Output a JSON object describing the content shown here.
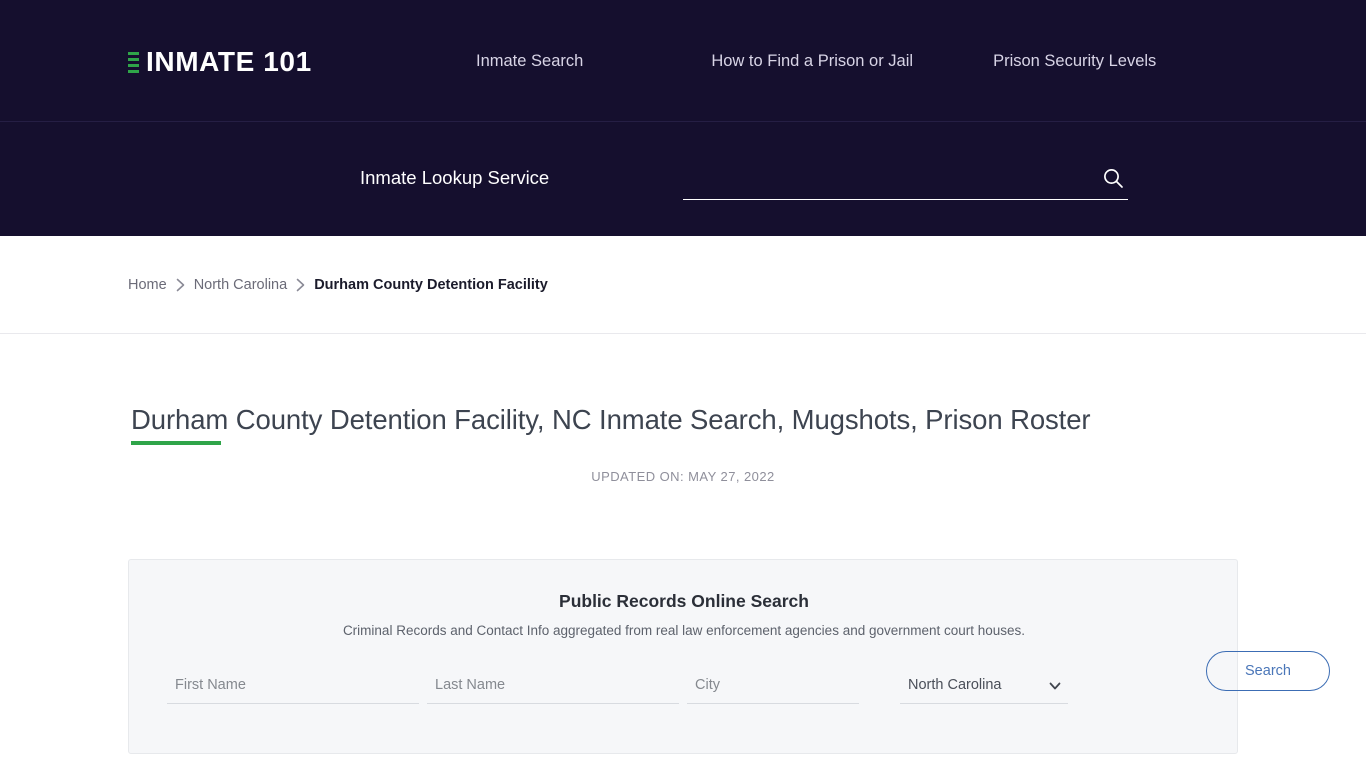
{
  "site": {
    "logo_text": "INMATE 101",
    "logo_mark": "green-bars-icon"
  },
  "nav": {
    "items": [
      {
        "label": "Inmate Search"
      },
      {
        "label": "How to Find a Prison or Jail"
      },
      {
        "label": "Prison Security Levels"
      }
    ]
  },
  "lookup": {
    "label": "Inmate Lookup Service",
    "input_value": "",
    "input_placeholder": "",
    "search_icon": "search-icon"
  },
  "breadcrumb": {
    "items": [
      {
        "label": "Home"
      },
      {
        "label": "North Carolina"
      }
    ],
    "separator": "›",
    "current": "Durham County Detention Facility"
  },
  "page": {
    "title": "Durham County Detention Facility, NC Inmate Search, Mugshots, Prison Roster",
    "updated": "UPDATED ON: MAY 27, 2022",
    "accent_color": "#2fa549"
  },
  "records_card": {
    "title": "Public Records Online Search",
    "subtitle": "Criminal Records and Contact Info aggregated from real law enforcement agencies and government court houses.",
    "fields": {
      "first_name": {
        "value": "",
        "placeholder": "First Name"
      },
      "last_name": {
        "value": "",
        "placeholder": "Last Name"
      },
      "city": {
        "value": "",
        "placeholder": "City"
      },
      "state": {
        "selected": "North Carolina",
        "options": [
          "North Carolina"
        ]
      }
    },
    "search_label": "Search",
    "search_color": "#4a76b8"
  },
  "colors": {
    "header_bg": "#150f2e",
    "card_bg": "#f6f7f9",
    "accent_green": "#2fa549"
  }
}
